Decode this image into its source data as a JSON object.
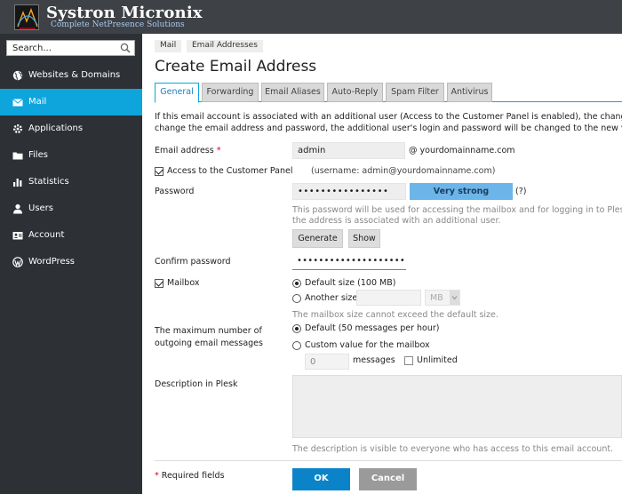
{
  "brand": {
    "name": "Systron Micronix",
    "tagline": "Complete NetPresence Solutions"
  },
  "colors": {
    "header_bg": "#3e4145",
    "sidebar_bg": "#2d3136",
    "accent": "#0ea5dd",
    "ok_button": "#0b83c8",
    "cancel_button": "#9a9a9a",
    "strength": "#6cb5e8"
  },
  "search": {
    "placeholder": "Search..."
  },
  "sidebar": {
    "items": [
      {
        "label": "Websites & Domains",
        "icon": "globe-icon",
        "active": false
      },
      {
        "label": "Mail",
        "icon": "envelope-icon",
        "active": true
      },
      {
        "label": "Applications",
        "icon": "gear-icon",
        "active": false
      },
      {
        "label": "Files",
        "icon": "folder-icon",
        "active": false
      },
      {
        "label": "Statistics",
        "icon": "bar-chart-icon",
        "active": false
      },
      {
        "label": "Users",
        "icon": "user-icon",
        "active": false
      },
      {
        "label": "Account",
        "icon": "id-card-icon",
        "active": false
      },
      {
        "label": "WordPress",
        "icon": "wordpress-icon",
        "active": false
      }
    ]
  },
  "breadcrumb": [
    "Mail",
    "Email Addresses"
  ],
  "page_title": "Create Email Address",
  "tabs": [
    "General",
    "Forwarding",
    "Email Aliases",
    "Auto-Reply",
    "Spam Filter",
    "Antivirus"
  ],
  "active_tab": "General",
  "info_lines": [
    "If this email account is associated with an additional user (Access to the Customer Panel is enabled), the changes you ma",
    "change the email address and password, the additional user's login and password will be changed to the new values as w"
  ],
  "form": {
    "email_label": "Email address",
    "required_mark": "*",
    "email_value": "admin",
    "domain_suffix": "@ yourdomainname.com",
    "access_label": "Access to the Customer Panel",
    "access_checked": true,
    "access_note": "(username: admin@yourdomainname.com)",
    "password_label": "Password",
    "password_value": "••••••••••••••••",
    "strength": "Very strong",
    "strength_help": "(?)",
    "password_hint_1": "This password will be used for accessing the mailbox and for logging in to Plesk if",
    "password_hint_2": "the address is associated with an additional user.",
    "generate_label": "Generate",
    "show_label": "Show",
    "confirm_label": "Confirm password",
    "confirm_value": "••••••••••••••••••••••",
    "mailbox_label": "Mailbox",
    "mailbox_checked": true,
    "default_size_label": "Default size (100 MB)",
    "another_size_label": "Another size",
    "size_unit": "MB",
    "mailbox_hint": "The mailbox size cannot exceed the default size.",
    "outgoing_label_1": "The maximum number of",
    "outgoing_label_2": "outgoing email messages",
    "outgoing_default_label": "Default (50 messages per hour)",
    "outgoing_custom_label": "Custom value for the mailbox",
    "outgoing_custom_value": "0",
    "messages_label": "messages",
    "unlimited_label": "Unlimited",
    "description_label": "Description in Plesk",
    "description_hint": "The description is visible to everyone who has access to this email account.",
    "required_fields_label": "Required fields"
  },
  "actions": {
    "ok_label": "OK",
    "cancel_label": "Cancel"
  }
}
